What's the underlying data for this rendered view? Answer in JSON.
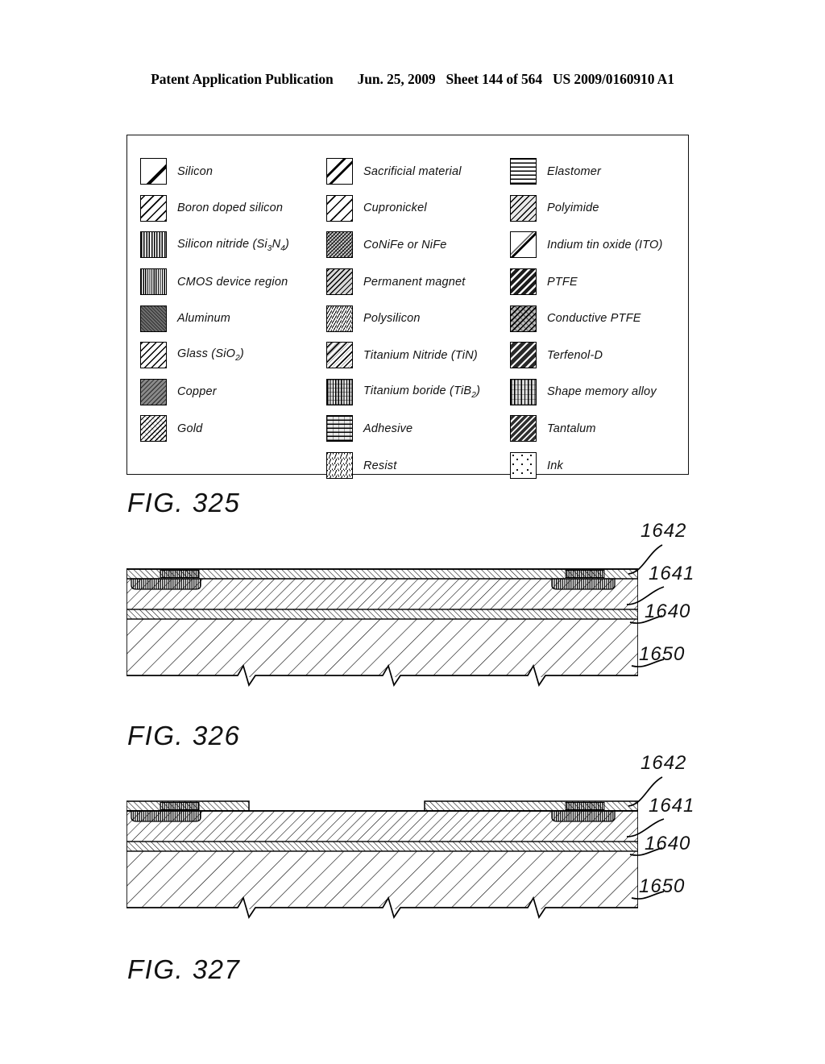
{
  "header": {
    "publication": "Patent Application Publication",
    "date": "Jun. 25, 2009",
    "sheet": "Sheet 144 of 564",
    "patent_number": "US 2009/0160910 A1"
  },
  "legend": {
    "columns": [
      {
        "items": [
          {
            "label": "Silicon",
            "pattern": "p-silicon",
            "icon": "silicon-swatch"
          },
          {
            "label": "Boron doped silicon",
            "pattern": "p-boron",
            "icon": "boron-doped-silicon-swatch"
          },
          {
            "label": "Silicon nitride (Si3N4)",
            "pattern": "p-sinitride",
            "icon": "silicon-nitride-swatch"
          },
          {
            "label": "CMOS device region",
            "pattern": "p-cmos",
            "icon": "cmos-device-region-swatch"
          },
          {
            "label": "Aluminum",
            "pattern": "p-aluminum",
            "icon": "aluminum-swatch"
          },
          {
            "label": "Glass (SiO2)",
            "pattern": "p-glass",
            "icon": "glass-swatch"
          },
          {
            "label": "Copper",
            "pattern": "p-copper",
            "icon": "copper-swatch"
          },
          {
            "label": "Gold",
            "pattern": "p-gold",
            "icon": "gold-swatch"
          }
        ]
      },
      {
        "items": [
          {
            "label": "Sacrificial material",
            "pattern": "p-sacrificial",
            "icon": "sacrificial-material-swatch"
          },
          {
            "label": "Cupronickel",
            "pattern": "p-cupronickel",
            "icon": "cupronickel-swatch"
          },
          {
            "label": "CoNiFe or NiFe",
            "pattern": "p-conife",
            "icon": "conife-swatch"
          },
          {
            "label": "Permanent magnet",
            "pattern": "p-permanent",
            "icon": "permanent-magnet-swatch"
          },
          {
            "label": "Polysilicon",
            "pattern": "p-polysilicon",
            "icon": "polysilicon-swatch"
          },
          {
            "label": "Titanium Nitride (TiN)",
            "pattern": "p-tin",
            "icon": "titanium-nitride-swatch"
          },
          {
            "label": "Titanium boride (TiB2)",
            "pattern": "p-tib2",
            "icon": "titanium-boride-swatch"
          },
          {
            "label": "Adhesive",
            "pattern": "p-adhesive",
            "icon": "adhesive-swatch"
          },
          {
            "label": "Resist",
            "pattern": "p-resist",
            "icon": "resist-swatch"
          }
        ]
      },
      {
        "items": [
          {
            "label": "Elastomer",
            "pattern": "p-elastomer",
            "icon": "elastomer-swatch"
          },
          {
            "label": "Polyimide",
            "pattern": "p-polyimide",
            "icon": "polyimide-swatch"
          },
          {
            "label": "Indium tin oxide (ITO)",
            "pattern": "p-ito",
            "icon": "indium-tin-oxide-swatch"
          },
          {
            "label": "PTFE",
            "pattern": "p-ptfe",
            "icon": "ptfe-swatch"
          },
          {
            "label": "Conductive PTFE",
            "pattern": "p-condptfe",
            "icon": "conductive-ptfe-swatch"
          },
          {
            "label": "Terfenol-D",
            "pattern": "p-terfenol",
            "icon": "terfenol-d-swatch"
          },
          {
            "label": "Shape memory alloy",
            "pattern": "p-sma",
            "icon": "shape-memory-alloy-swatch"
          },
          {
            "label": "Tantalum",
            "pattern": "p-tantalum",
            "icon": "tantalum-swatch"
          },
          {
            "label": "Ink",
            "pattern": "p-ink",
            "icon": "ink-swatch"
          }
        ]
      }
    ]
  },
  "figures": {
    "fig325": {
      "caption": "FIG. 325"
    },
    "fig326": {
      "caption": "FIG. 326",
      "reference_numerals": [
        "1642",
        "1641",
        "1640",
        "1650"
      ]
    },
    "fig327": {
      "caption": "FIG. 327",
      "reference_numerals": [
        "1642",
        "1641",
        "1640",
        "1650"
      ]
    }
  }
}
